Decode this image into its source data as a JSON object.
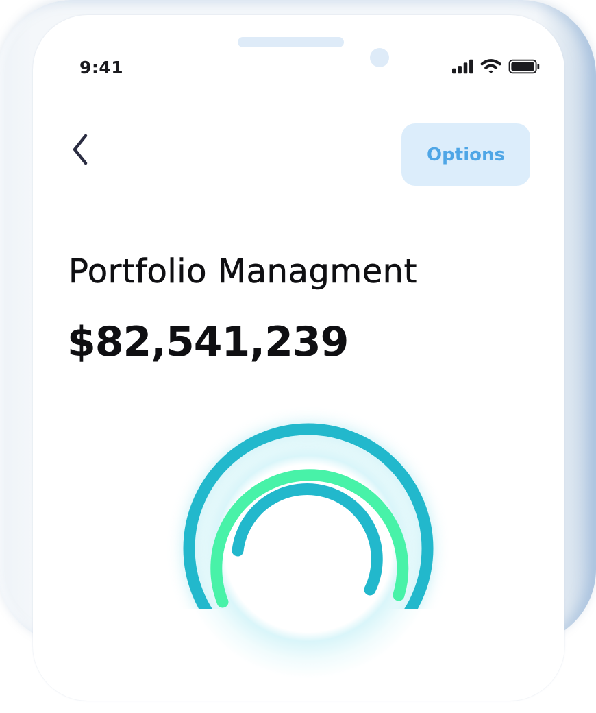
{
  "status_bar": {
    "time": "9:41",
    "icons": [
      "cellular-signal-icon",
      "wifi-icon",
      "battery-icon"
    ]
  },
  "header": {
    "back_icon": "chevron-left-icon",
    "options_label": "Options"
  },
  "portfolio": {
    "title": "Portfolio Managment",
    "total_value": "$82,541,239"
  },
  "colors": {
    "accent_blue": "#4fa6e6",
    "options_bg": "#dcedfb",
    "ring_teal": "#22b8cc",
    "ring_green": "#48f2a8",
    "text_dark": "#0f0f12"
  }
}
